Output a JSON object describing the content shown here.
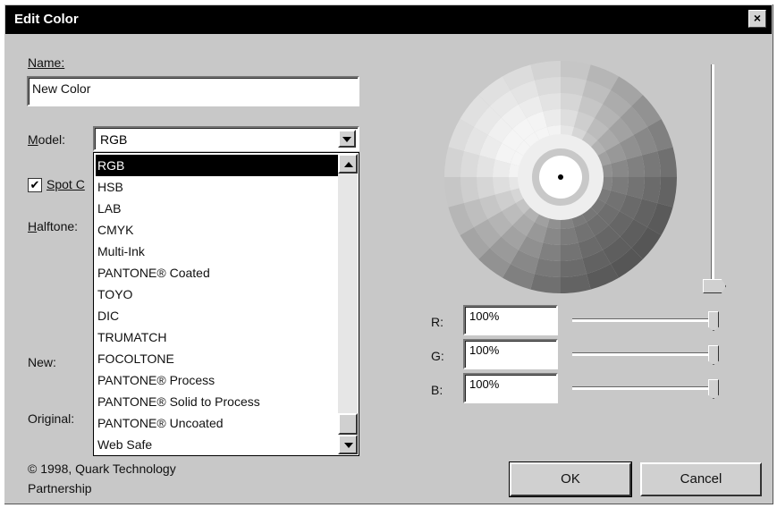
{
  "window": {
    "title": "Edit Color",
    "close_label": "×"
  },
  "name": {
    "label": "Name:",
    "value": "New Color"
  },
  "model": {
    "label": "Model:",
    "selected": "RGB",
    "options": [
      "RGB",
      "HSB",
      "LAB",
      "CMYK",
      "Multi-Ink",
      "PANTONE® Coated",
      "TOYO",
      "DIC",
      "TRUMATCH",
      "FOCOLTONE",
      "PANTONE® Process",
      "PANTONE® Solid to Process",
      "PANTONE® Uncoated",
      "Web Safe"
    ]
  },
  "spot_color": {
    "label": "Spot C",
    "checked": true,
    "check_glyph": "✔"
  },
  "halftone": {
    "label": "Halftone:"
  },
  "preview": {
    "new_label": "New:",
    "original_label": "Original:"
  },
  "copyright": {
    "line1": "© 1998, Quark Technology",
    "line2": "Partnership"
  },
  "rgb": {
    "r_label": "R:",
    "r_value": "100%",
    "g_label": "G:",
    "g_value": "100%",
    "b_label": "B:",
    "b_value": "100%"
  },
  "buttons": {
    "ok": "OK",
    "cancel": "Cancel"
  },
  "brightness_level": 1.0,
  "colors": {
    "title_bg": "#000000",
    "dialog_bg": "#c8c8c8",
    "selection": "#000000"
  }
}
